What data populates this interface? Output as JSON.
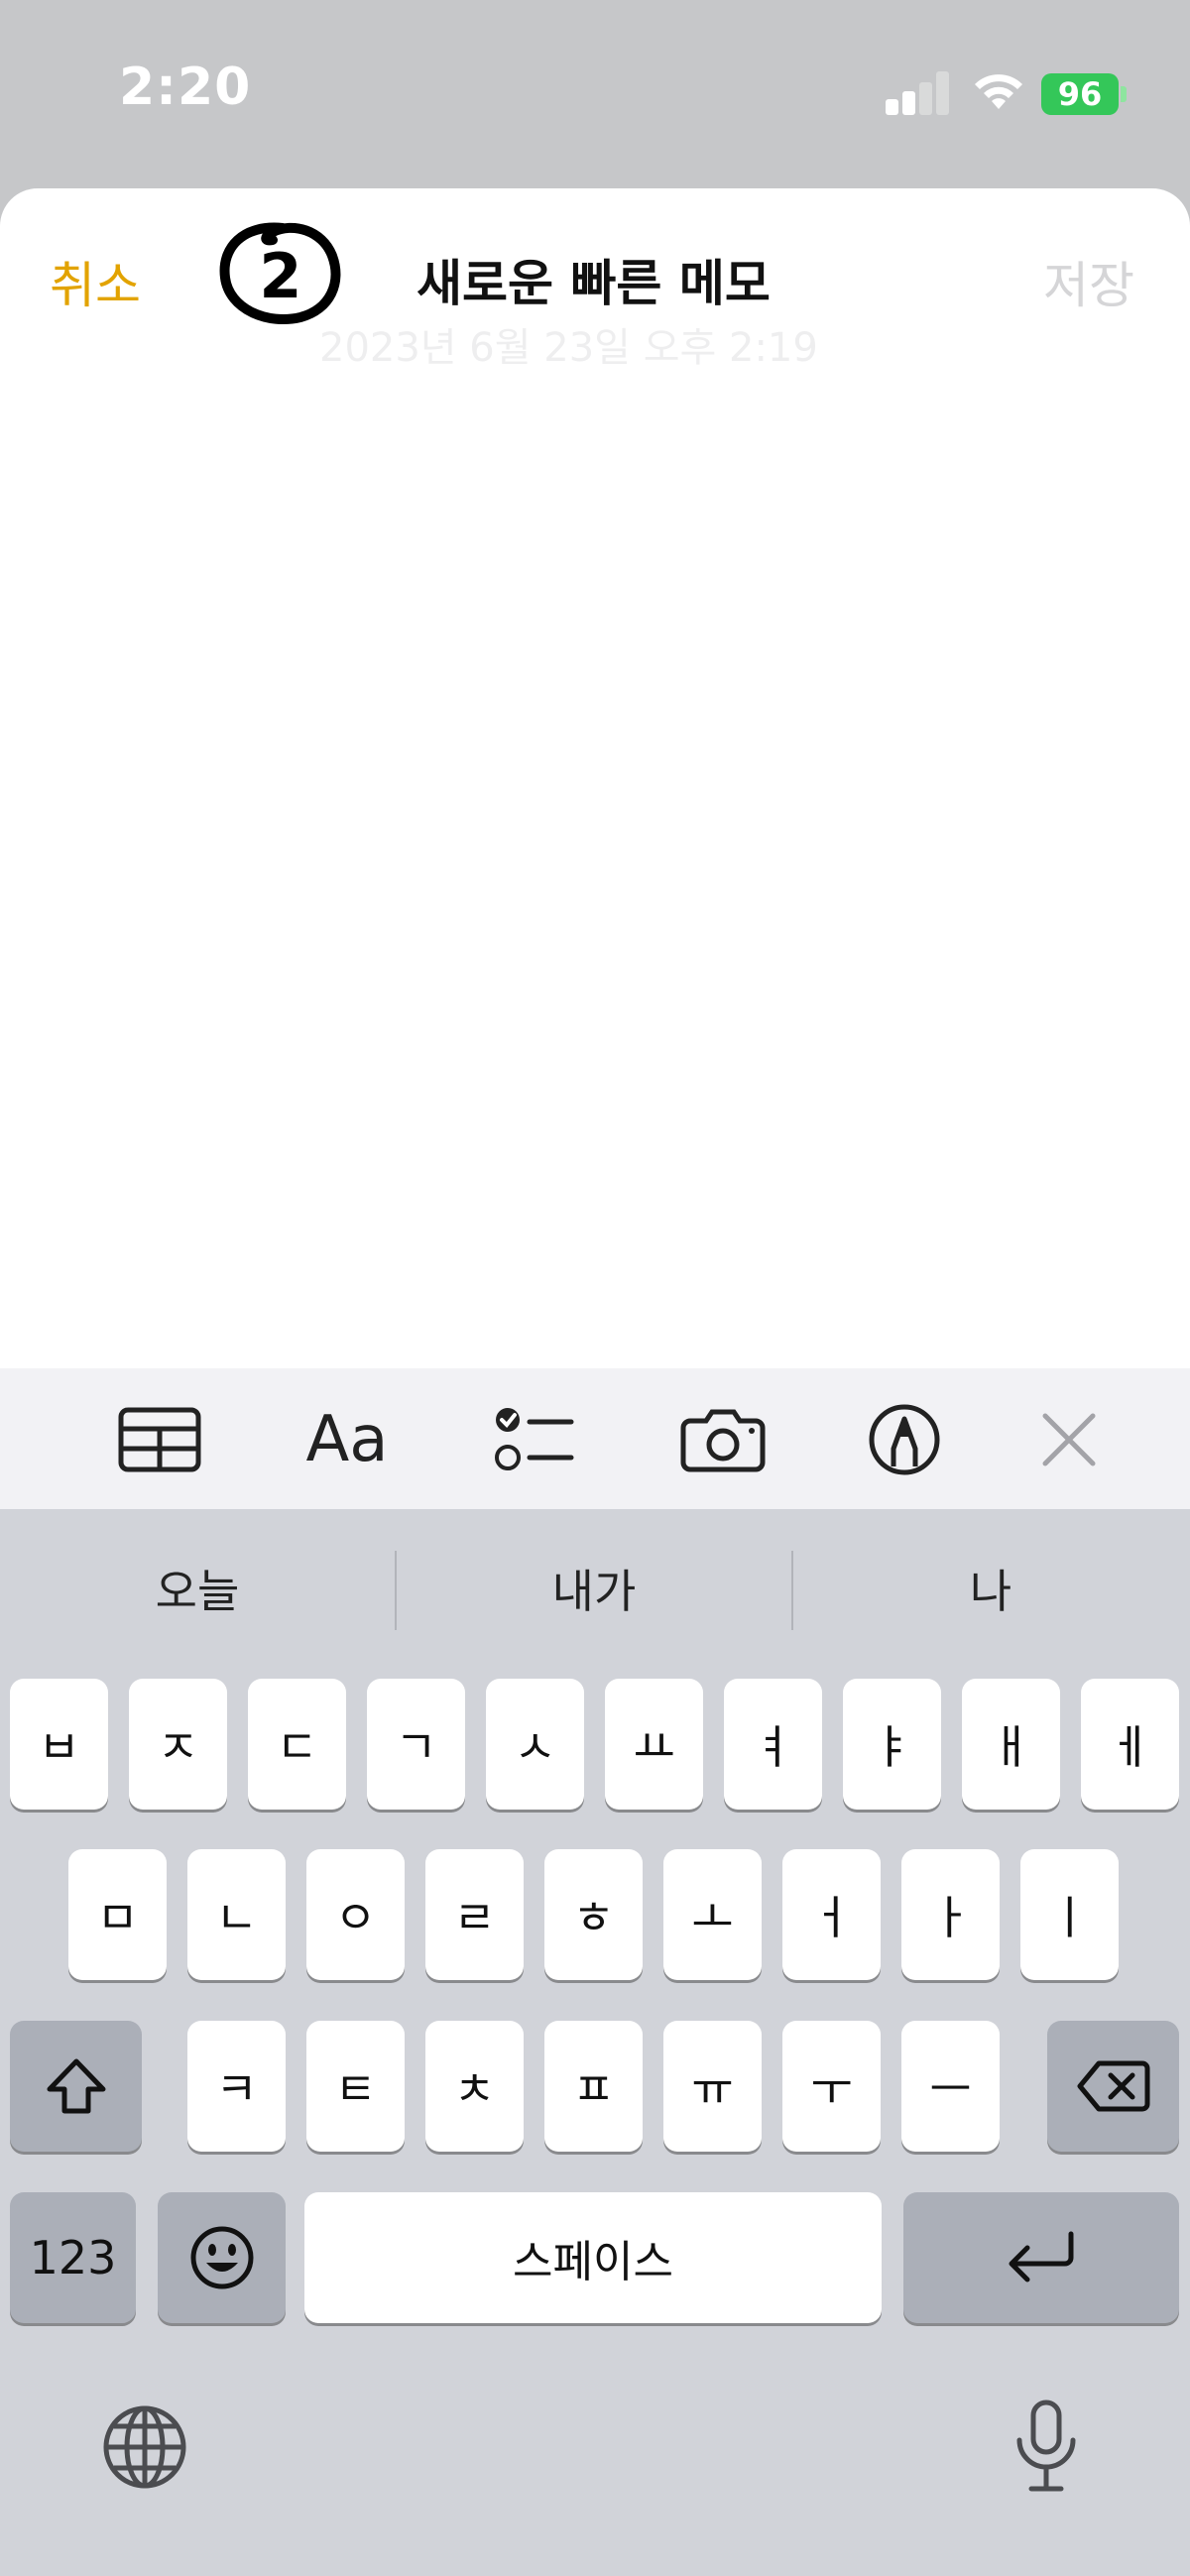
{
  "status_bar": {
    "time": "2:20",
    "battery_level": "96"
  },
  "header": {
    "cancel_label": "취소",
    "annotation_number": "2",
    "title": "새로운 빠른 메모",
    "save_label": "저장",
    "date_text": "2023년 6월 23일 오후 2:19"
  },
  "toolbar": {
    "items": [
      {
        "icon": "table-icon"
      },
      {
        "label": "Aa",
        "icon": "text-format-icon"
      },
      {
        "icon": "checklist-icon"
      },
      {
        "icon": "camera-icon"
      },
      {
        "icon": "markup-pen-icon"
      },
      {
        "icon": "close-icon"
      }
    ]
  },
  "keyboard": {
    "suggestions": [
      "오늘",
      "내가",
      "나"
    ],
    "row1": [
      "ㅂ",
      "ㅈ",
      "ㄷ",
      "ㄱ",
      "ㅅ",
      "ㅛ",
      "ㅕ",
      "ㅑ",
      "ㅐ",
      "ㅔ"
    ],
    "row2": [
      "ㅁ",
      "ㄴ",
      "ㅇ",
      "ㄹ",
      "ㅎ",
      "ㅗ",
      "ㅓ",
      "ㅏ",
      "ㅣ"
    ],
    "row3": [
      "ㅋ",
      "ㅌ",
      "ㅊ",
      "ㅍ",
      "ㅠ",
      "ㅜ",
      "ㅡ"
    ],
    "numbers_label": "123",
    "space_label": "스페이스",
    "icons": {
      "shift": "shift-icon",
      "delete": "delete-icon",
      "emoji": "emoji-icon",
      "return": "return-icon",
      "globe": "globe-icon",
      "mic": "microphone-icon"
    }
  },
  "colors": {
    "accent": "#e2a300",
    "battery": "#34c759",
    "keyboard_bg": "#d1d3d9"
  }
}
